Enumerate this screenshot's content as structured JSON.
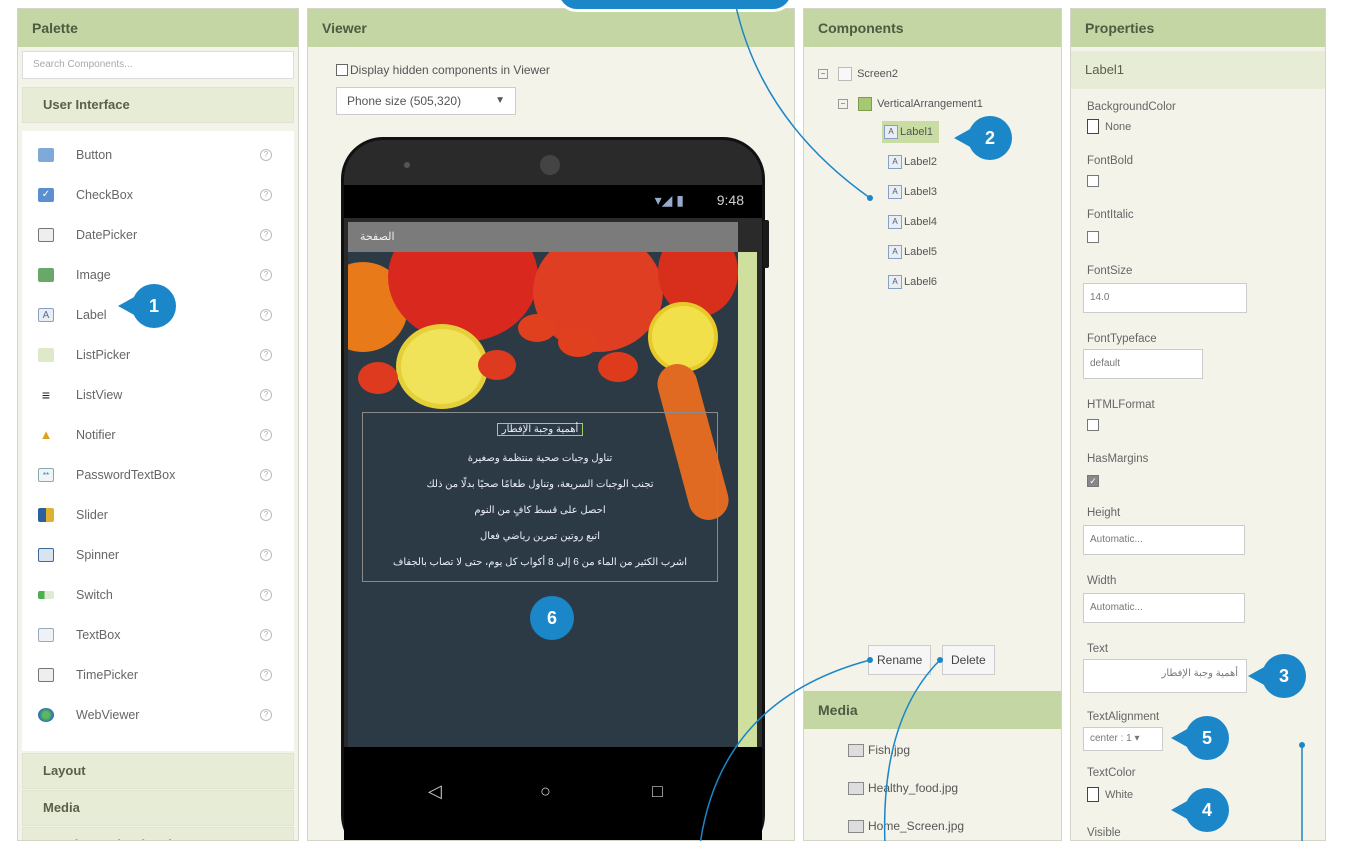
{
  "palette": {
    "title": "Palette",
    "search_placeholder": "Search Components...",
    "category_user_interface": "User Interface",
    "items": [
      {
        "label": "Button",
        "icon": "button-icon"
      },
      {
        "label": "CheckBox",
        "icon": "checkbox-icon"
      },
      {
        "label": "DatePicker",
        "icon": "datepicker-icon"
      },
      {
        "label": "Image",
        "icon": "image-icon"
      },
      {
        "label": "Label",
        "icon": "label-icon"
      },
      {
        "label": "ListPicker",
        "icon": "listpicker-icon"
      },
      {
        "label": "ListView",
        "icon": "listview-icon"
      },
      {
        "label": "Notifier",
        "icon": "notifier-icon"
      },
      {
        "label": "PasswordTextBox",
        "icon": "passwordtextbox-icon"
      },
      {
        "label": "Slider",
        "icon": "slider-icon"
      },
      {
        "label": "Spinner",
        "icon": "spinner-icon"
      },
      {
        "label": "Switch",
        "icon": "switch-icon"
      },
      {
        "label": "TextBox",
        "icon": "textbox-icon"
      },
      {
        "label": "TimePicker",
        "icon": "timepicker-icon"
      },
      {
        "label": "WebViewer",
        "icon": "webviewer-icon"
      }
    ],
    "help_glyph": "?",
    "category_layout": "Layout",
    "category_media": "Media",
    "category_drawing": "Drawing and Animation"
  },
  "viewer": {
    "title": "Viewer",
    "hidden_label": "Display hidden components in Viewer",
    "size_selected": "Phone size (505,320)",
    "phone": {
      "time": "9:48",
      "screen_title": "الصفحة",
      "heading": "أهمية وجبة الإفطار",
      "lines": [
        "تناول وجبات صحية منتظمة وصغيرة",
        "تجنب الوجبات السريعة، وتناول طعامًا صحيًا بدلًا من ذلك",
        "احصل على قسط كافٍ من النوم",
        "اتبع روتين تمرين رياضي فعال",
        "اشرب الكثير من الماء من 6 إلى 8 أكواب كل يوم، حتى لا تصاب بالجفاف"
      ],
      "nav_back": "◁",
      "nav_home": "○",
      "nav_recent": "□"
    }
  },
  "components": {
    "title": "Components",
    "screen": "Screen2",
    "arrangement": "VerticalArrangement1",
    "labels": [
      "Label1",
      "Label2",
      "Label3",
      "Label4",
      "Label5",
      "Label6"
    ],
    "selected": "Label1",
    "rename_label": "Rename",
    "delete_label": "Delete",
    "media_title": "Media",
    "media_files": [
      "Fish.jpg",
      "Healthy_food.jpg",
      "Home_Screen.jpg"
    ]
  },
  "properties": {
    "title": "Properties",
    "component": "Label1",
    "background_color_label": "BackgroundColor",
    "background_color_value": "None",
    "font_bold_label": "FontBold",
    "font_italic_label": "FontItalic",
    "font_size_label": "FontSize",
    "font_size_value": "14.0",
    "font_typeface_label": "FontTypeface",
    "font_typeface_value": "default",
    "html_format_label": "HTMLFormat",
    "has_margins_label": "HasMargins",
    "height_label": "Height",
    "height_value": "Automatic...",
    "width_label": "Width",
    "width_value": "Automatic...",
    "text_label": "Text",
    "text_value": "أهمية وجبة الإفطار",
    "text_alignment_label": "TextAlignment",
    "text_alignment_value": "center : 1",
    "text_color_label": "TextColor",
    "text_color_value": "White",
    "visible_label": "Visible"
  },
  "callouts": [
    "1",
    "2",
    "3",
    "4",
    "5",
    "6"
  ],
  "colors": {
    "accent": "#1b86c8",
    "panel_header": "#c3d6a3",
    "selected": "#c9dca3"
  }
}
